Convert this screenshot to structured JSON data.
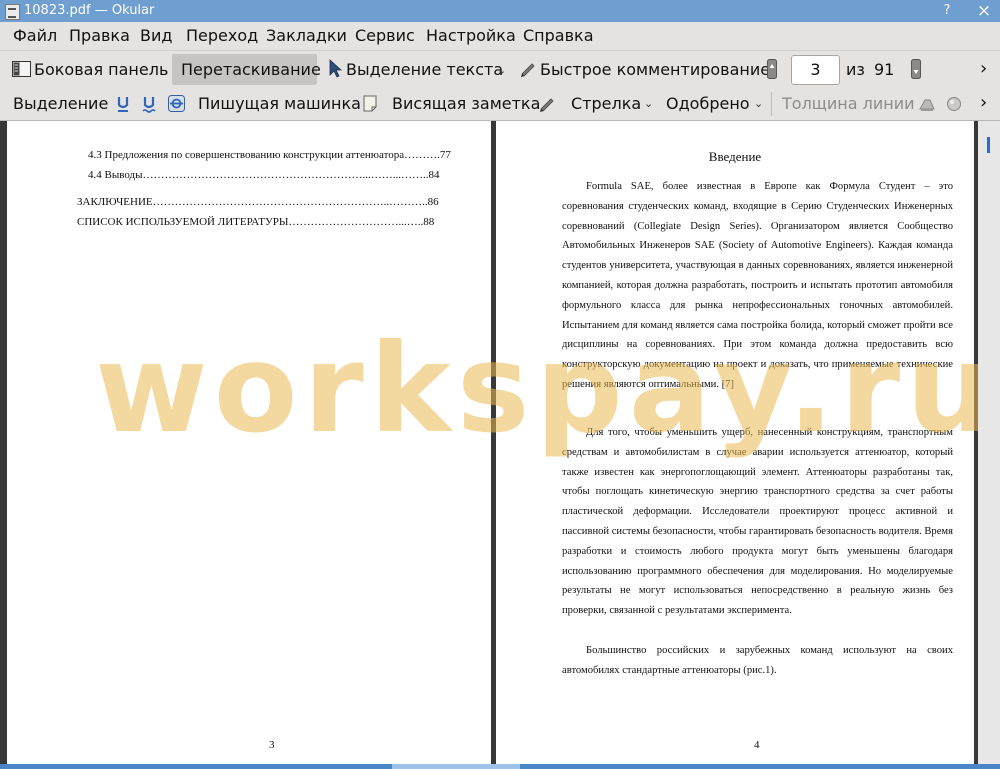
{
  "window": {
    "title": "10823.pdf  — Okular",
    "help_btn": "?",
    "close_btn": "×"
  },
  "menu": {
    "items": [
      "Файл",
      "Правка",
      "Вид",
      "Переход",
      "Закладки",
      "Сервис",
      "Настройка",
      "Справка"
    ]
  },
  "toolbar1": {
    "sidebar": "Боковая панель",
    "browse": "Перетаскивание",
    "text_select": "Выделение текста",
    "quick_annotations": "Быстрое комментирование",
    "page_current": "3",
    "page_of": "из",
    "page_total": "91",
    "more": "›"
  },
  "toolbar2": {
    "highlight": "Выделение",
    "typewriter": "Пишущая машинка",
    "popup_note": "Висящая заметка",
    "arrow": "Стрелка",
    "stamp": "Одобрено",
    "line_width": "Толщина линии",
    "more": "›"
  },
  "left_page": {
    "toc": [
      {
        "text": "4.3 Предложения по совершенствованию конструкции аттенюатора……….77"
      },
      {
        "text": "4.4 Выводы……………………………………………………...……...……..84"
      },
      {
        "text": "ЗАКЛЮЧЕНИЕ………………………………………………………..………..86"
      },
      {
        "text": "СПИСОК ИСПОЛЬЗУЕМОЙ ЛИТЕРАТУРЫ…………………………...…..88"
      }
    ],
    "page_number": "3"
  },
  "right_page": {
    "heading": "Введение",
    "paragraphs": [
      "Formula SAE, более известная в Европе как Формула Студент – это соревнования студенческих команд, входящие в Серию Студенческих Инженерных соревнований (Collegiate Design Series). Организатором является Сообщество Автомобильных Инженеров SAE (Society of Automotive Engineers). Каждая команда студентов университета, участвующая в данных соревнованиях, является инженерной компанией, которая должна разработать, построить и испытать прототип автомобиля формульного класса для рынка непрофессиональных гоночных автомобилей. Испытанием для команд является сама постройка болида, который сможет пройти все дисциплины на соревнованиях. При этом команда должна предоставить всю конструкторскую документацию на проект и доказать, что применяемые технические решения являются оптимальными. [7]",
      "Для того, чтобы уменьшить ущерб, нанесенный конструкциям, транспортным средствам и автомобилистам в случае аварии используется аттенюатор, который также известен как энергопоглощающий элемент. Аттенюаторы разработаны так, чтобы поглощать кинетическую энергию транспортного средства за счет работы пластической деформации. Исследователи проектируют процесс активной и пассивной системы безопасности, чтобы гарантировать безопасность водителя. Время разработки и стоимость любого продукта могут быть уменьшены благодаря использованию программного обеспечения для моделирования. Но моделируемые результаты не могут использоваться непосредственно в реальную жизнь без проверки, связанной с результатами эксперимента.",
      "Большинство российских и зарубежных команд используют на своих автомобилях стандартные аттенюаторы (рис.1)."
    ],
    "page_number": "4"
  },
  "watermark": "workspay.ru",
  "colors": {
    "titlebar": "#6f9fd0",
    "toolbar": "#e4e3e2",
    "accent": "#2d6ccf",
    "watermark": "#e9ba50"
  }
}
